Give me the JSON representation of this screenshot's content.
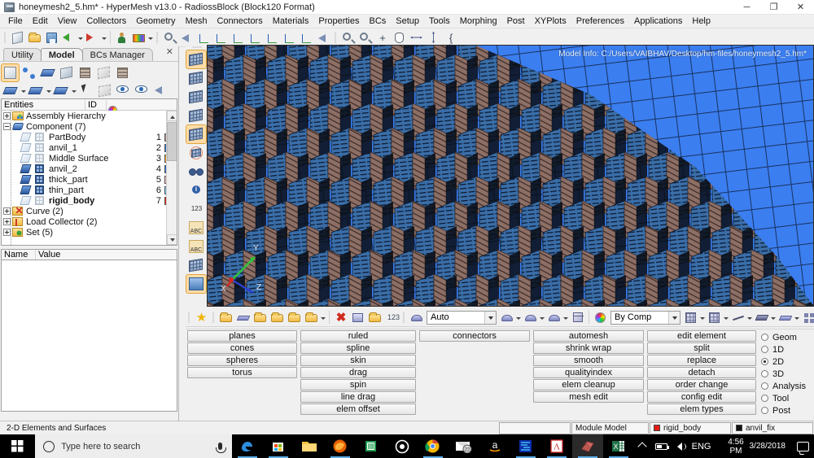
{
  "window": {
    "title": "honeymesh2_5.hm* - HyperMesh v13.0 - RadiossBlock (Block120 Format)",
    "app_icon": "hypermesh-icon",
    "minimize": "─",
    "maximize": "❐",
    "close": "✕"
  },
  "menubar": {
    "items": [
      {
        "label": "File"
      },
      {
        "label": "Edit"
      },
      {
        "label": "View"
      },
      {
        "label": "Collectors"
      },
      {
        "label": "Geometry"
      },
      {
        "label": "Mesh"
      },
      {
        "label": "Connectors"
      },
      {
        "label": "Materials"
      },
      {
        "label": "Properties"
      },
      {
        "label": "BCs"
      },
      {
        "label": "Setup"
      },
      {
        "label": "Tools"
      },
      {
        "label": "Morphing"
      },
      {
        "label": "Post"
      },
      {
        "label": "XYPlots"
      },
      {
        "label": "Preferences"
      },
      {
        "label": "Applications"
      },
      {
        "label": "Help"
      }
    ]
  },
  "toolbar": {
    "file_group": [
      "open-model-icon",
      "import-model-icon",
      "save-model-icon",
      "export-solver-deck-icon",
      "import-solver-deck-icon"
    ],
    "user_group": [
      "user-profile-icon",
      "color-folder-icon"
    ],
    "view_group": [
      "zoom-fit-icon",
      "previous-view-icon",
      "xy-view-icon",
      "yz-view-icon",
      "zx-view-icon",
      "xz-view-icon",
      "yx-view-icon",
      "zy-view-icon",
      "rotate-view-icon",
      "arrow-view-icon"
    ],
    "nav_group": [
      "zoom-out-icon",
      "zoom-in-icon",
      "fit-icon",
      "pan-icon",
      "arrows-horizontal-icon",
      "arrows-vertical-icon",
      "braces-icon"
    ],
    "braces_glyph": "{ }"
  },
  "left_panel": {
    "tabs": [
      {
        "label": "Utility",
        "active": false
      },
      {
        "label": "Model",
        "active": true
      },
      {
        "label": "BCs Manager",
        "active": false
      }
    ],
    "close_glyph": "✕",
    "toolbar_row1": [
      "panel-view-icon",
      "assembly-icon",
      "component-icon",
      "include-icon",
      "load-collector-icon",
      "ghost-icon",
      "stack-icon"
    ],
    "toolbar_row2": [
      "geometry-display-icon",
      "component-display-icon",
      "mesh-display-icon",
      "pointer-icon",
      "note-icon",
      "show-hide-all-icon",
      "isolate-icon",
      "reverse-icon"
    ],
    "tree_header": {
      "entities": "Entities",
      "id": "ID",
      "color": "color-wheel-icon"
    },
    "tree": [
      {
        "label": "Assembly Hierarchy",
        "expander": "plus",
        "icon": "assembly-folder-icon",
        "depth": 0,
        "id": "",
        "swatch": ""
      },
      {
        "label": "Component (7)",
        "expander": "minus",
        "icon": "component-folder-icon",
        "depth": 0,
        "id": "",
        "swatch": ""
      },
      {
        "label": "PartBody",
        "expander": "",
        "icon": "component-item-icon",
        "depth": 1,
        "id": "1",
        "swatch": "#b08b84",
        "geom_on": false,
        "mesh_on": false,
        "bold": false
      },
      {
        "label": "anvil_1",
        "expander": "",
        "icon": "component-item-icon",
        "depth": 1,
        "id": "2",
        "swatch": "#2f6fd0",
        "geom_on": false,
        "mesh_on": false,
        "bold": false
      },
      {
        "label": "Middle Surface",
        "expander": "",
        "icon": "component-item-icon",
        "depth": 1,
        "id": "3",
        "swatch": "#f0a51e",
        "geom_on": false,
        "mesh_on": false,
        "bold": false
      },
      {
        "label": "anvil_2",
        "expander": "",
        "icon": "component-item-icon",
        "depth": 1,
        "id": "4",
        "swatch": "#2f6fd0",
        "geom_on": true,
        "mesh_on": true,
        "bold": false
      },
      {
        "label": "thick_part",
        "expander": "",
        "icon": "component-item-icon",
        "depth": 1,
        "id": "5",
        "swatch": "#f0b9b9",
        "geom_on": true,
        "mesh_on": true,
        "bold": false
      },
      {
        "label": "thin_part",
        "expander": "",
        "icon": "component-item-icon",
        "depth": 1,
        "id": "6",
        "swatch": "#7cc4ee",
        "geom_on": true,
        "mesh_on": true,
        "bold": false
      },
      {
        "label": "rigid_body",
        "expander": "",
        "icon": "component-item-icon",
        "depth": 1,
        "id": "7",
        "swatch": "#e81c14",
        "geom_on": false,
        "mesh_on": false,
        "bold": true
      },
      {
        "label": "Curve (2)",
        "expander": "plus",
        "icon": "curve-folder-icon",
        "depth": 0,
        "id": "",
        "swatch": ""
      },
      {
        "label": "Load Collector (2)",
        "expander": "plus",
        "icon": "load-collector-folder-icon",
        "depth": 0,
        "id": "",
        "swatch": ""
      },
      {
        "label": "Set (5)",
        "expander": "plus",
        "icon": "set-folder-icon",
        "depth": 0,
        "id": "",
        "swatch": ""
      }
    ],
    "namevalue": {
      "name_header": "Name",
      "value_header": "Value"
    }
  },
  "vertical_toolbar": {
    "icons": [
      "mesh-highlighted-icon",
      "mesh-arrow-icon",
      "mesh-shrink-icon",
      "mesh-plain-icon",
      "mesh-box-icon",
      "circle-mesh-icon",
      "binoculars-icon",
      "info-icon",
      "numbers-icon",
      "mesh-abc-icon",
      "load-abc-icon",
      "mesh-transfer-icon",
      "surface-edit-icon"
    ]
  },
  "viewport": {
    "model_info": "Model Info: C:/Users/VAIBHAV/Desktop/hm-files/honeymesh2_5.hm*",
    "axis_x": "X",
    "axis_y": "Y",
    "axis_z": "Z",
    "background_color": "#3b7ef0",
    "mesh_line_color": "#18325f",
    "honeycomb_blue": "#3a6ea8",
    "honeycomb_brown": "#8d6f66"
  },
  "lower_toolbar": {
    "star_icon": "favorites-icon",
    "collector_icons": [
      "create-component-icon",
      "component-icon",
      "include-icon",
      "assign-icon",
      "import-icon",
      "organize-icon"
    ],
    "delete_icons": [
      "delete-icon",
      "mask-icon",
      "find-icon",
      "numbers-icon"
    ],
    "color_combo": {
      "value": "Auto",
      "icon": "color-palette-icon"
    },
    "shape_icons": [
      "surface-shade-icon",
      "surface-mesh-icon",
      "element-shade-icon",
      "cube-icon"
    ],
    "bycomp_combo": {
      "value": "By Comp",
      "icon": "color-wheel-icon"
    },
    "display_icons": [
      "wireframe-icon",
      "shaded-mesh-icon",
      "line-icon",
      "element-stack-icon",
      "plate-icon",
      "four-square-icon",
      "monitor-icon"
    ]
  },
  "panel_buttons": {
    "col1": [
      "planes",
      "cones",
      "spheres",
      "torus"
    ],
    "col2": [
      "ruled",
      "spline",
      "skin",
      "drag",
      "spin",
      "line drag",
      "elem offset"
    ],
    "col3": [
      "connectors"
    ],
    "col4": [
      "automesh",
      "shrink wrap",
      "smooth",
      "qualityindex",
      "elem cleanup",
      "mesh edit"
    ],
    "col5": [
      "edit element",
      "split",
      "replace",
      "detach",
      "order change",
      "config edit",
      "elem types"
    ],
    "radios": [
      {
        "label": "Geom",
        "selected": false
      },
      {
        "label": "1D",
        "selected": false
      },
      {
        "label": "2D",
        "selected": true
      },
      {
        "label": "3D",
        "selected": false
      },
      {
        "label": "Analysis",
        "selected": false
      },
      {
        "label": "Tool",
        "selected": false
      },
      {
        "label": "Post",
        "selected": false
      }
    ]
  },
  "statusbar": {
    "message": "2-D Elements and Surfaces",
    "blank_cell": "",
    "module": "Module Model",
    "component": {
      "label": "rigid_body",
      "color": "#e81c14"
    },
    "set": {
      "label": "anvil_fix",
      "color": "#111111"
    }
  },
  "taskbar": {
    "start": "start-button-icon",
    "search_placeholder": "Type here to search",
    "search_icon": "search-circle-icon",
    "mic_icon": "microphone-icon",
    "apps": [
      {
        "name": "edge-icon",
        "active": true
      },
      {
        "name": "microsoft-store-icon",
        "active": true
      },
      {
        "name": "file-explorer-icon",
        "active": false
      },
      {
        "name": "firefox-icon",
        "active": true
      },
      {
        "name": "abbyy-icon",
        "active": false
      },
      {
        "name": "cortana-icon",
        "active": false
      },
      {
        "name": "chrome-icon",
        "active": true
      },
      {
        "name": "mail-icon",
        "active": false,
        "badge": "22"
      },
      {
        "name": "amazon-icon",
        "active": false
      },
      {
        "name": "solver-icon",
        "active": true
      },
      {
        "name": "adobe-reader-icon",
        "active": true
      },
      {
        "name": "hypermesh-icon",
        "active": true
      },
      {
        "name": "excel-icon",
        "active": true
      }
    ],
    "tray": {
      "chevron": "show-hidden-icons",
      "battery": "battery-icon",
      "volume": "volume-icon",
      "language": "ENG",
      "time": "4:56 PM",
      "date": "3/28/2018",
      "notifications": "action-center-icon"
    }
  }
}
